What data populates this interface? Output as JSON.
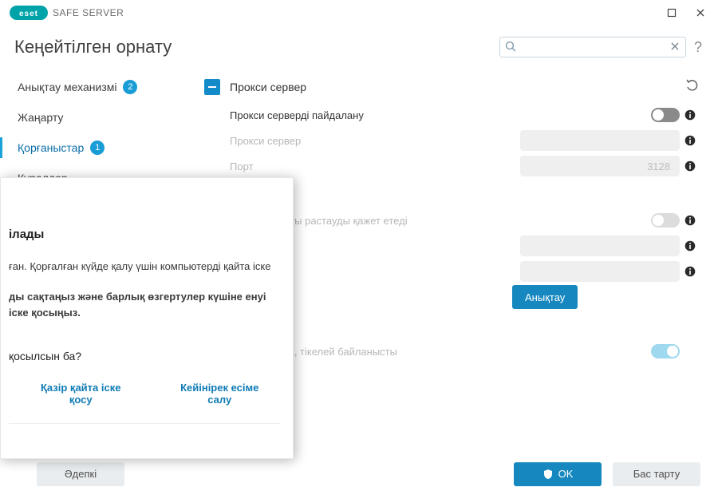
{
  "titlebar": {
    "brand_strong": "eset",
    "brand_rest": "SAFE SERVER"
  },
  "page_title": "Кеңейтілген орнату",
  "help_glyph": "?",
  "search": {
    "placeholder": ""
  },
  "sidebar": {
    "items": [
      {
        "label": "Анықтау механизмі",
        "badge": "2"
      },
      {
        "label": "Жаңарту"
      },
      {
        "label": "Қорғаныстар",
        "badge": "1"
      },
      {
        "label": "Құралдар"
      }
    ]
  },
  "section": {
    "title": "Прокси сервер",
    "rows": {
      "use_proxy": "Прокси серверді пайдалану",
      "proxy_server": "Прокси сервер",
      "port": "Порт",
      "port_value": "3128",
      "auth_required": "түпнұсқалықты растауды қажет етеді",
      "username_trail": "ы",
      "detect": "анықтау",
      "detect_btn": "Анықтау",
      "fallback": "егіді болмаса, тікелей байланысты"
    }
  },
  "modal": {
    "title": "ілады",
    "line1": "ған. Қорғалған күйде қалу үшін компьютерді қайта іске",
    "line2_bold": "ды сақтаңыз және барлық өзгертулер күшіне енуі",
    "line3_bold": "іске қосыңыз.",
    "prompt": "қосылсын ба?",
    "restart_now": "Қазір қайта іске қосу",
    "remind_later": "Кейінірек есіме салу"
  },
  "bottom": {
    "default": "Әдепкі",
    "ok": "OK",
    "cancel": "Бас тарту"
  }
}
